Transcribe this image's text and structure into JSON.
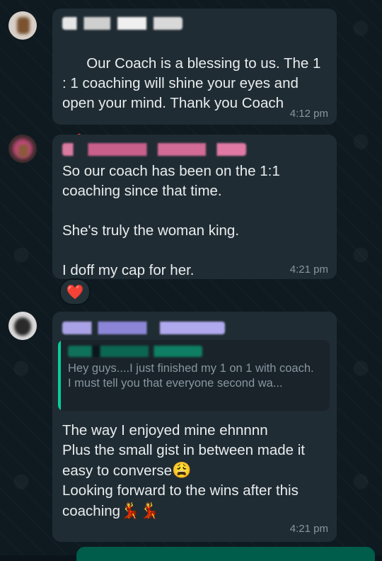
{
  "messages": [
    {
      "text": "Our Coach is a blessing to us. The 1 : 1 coaching will shine your eyes and open your mind. Thank you Coach",
      "emoji": "🥰",
      "time": "4:12 pm"
    },
    {
      "text": "So our coach has been on the 1:1 coaching since that time.\n\nShe's truly the woman king.\n\nI doff my cap for her.",
      "time": "4:21 pm",
      "reaction": "❤️"
    },
    {
      "quoted": {
        "line1": "Hey guys....I just finished my 1 on 1 with coach.",
        "line2": "I must tell you that everyone second wa..."
      },
      "text_before_emoji1": "The way I enjoyed mine ehnnnn\nPlus the small gist in between made it easy to converse",
      "emoji1": "😩",
      "text_before_emoji2": "\nLooking forward to the wins after this coaching",
      "emoji2": "💃💃",
      "time": "4:21 pm"
    }
  ],
  "colors": {
    "bubble": "#202c33",
    "text": "#e9edef",
    "meta": "#8696a0",
    "accent": "#06cf9c"
  }
}
